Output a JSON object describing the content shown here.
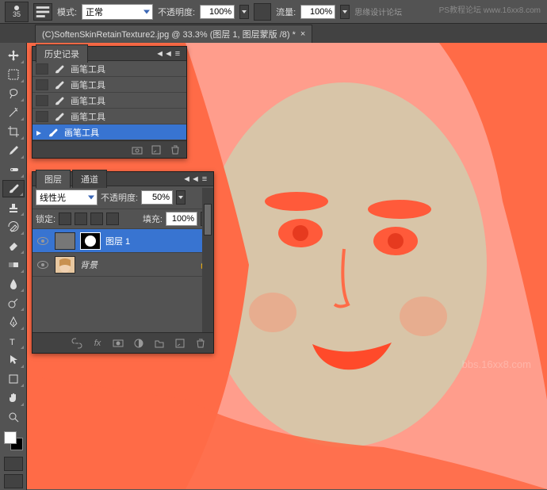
{
  "options": {
    "brush_size": "35",
    "mode_label": "模式:",
    "mode_value": "正常",
    "opacity_label": "不透明度:",
    "opacity_value": "100%",
    "flow_label": "流量:",
    "flow_value": "100%",
    "watermark_text": "思缘设计论坛"
  },
  "document": {
    "tab_title": "(C)SoftenSkinRetainTexture2.jpg @ 33.3% (图层 1, 图层蒙版 /8) *"
  },
  "history": {
    "title": "历史记录",
    "items": [
      {
        "label": "画笔工具",
        "selected": false
      },
      {
        "label": "画笔工具",
        "selected": false
      },
      {
        "label": "画笔工具",
        "selected": false
      },
      {
        "label": "画笔工具",
        "selected": false
      },
      {
        "label": "画笔工具",
        "selected": true
      }
    ]
  },
  "layers": {
    "tab_layers": "图层",
    "tab_channels": "通道",
    "blend_mode": "线性光",
    "opacity_label": "不透明度:",
    "opacity_value": "50%",
    "lock_label": "锁定:",
    "fill_label": "填充:",
    "fill_value": "100%",
    "items": [
      {
        "name": "图层 1",
        "selected": true,
        "has_mask": true
      },
      {
        "name": "背景",
        "selected": false,
        "has_mask": false,
        "locked": true
      }
    ]
  },
  "watermark": {
    "corner": "PS教程论坛  www.16xx8.com",
    "bottom": "bbs.16xx8.com"
  },
  "tools": [
    "move",
    "marquee",
    "lasso",
    "magic-wand",
    "crop",
    "eyedropper",
    "spot-heal",
    "brush",
    "stamp",
    "history-brush",
    "eraser",
    "gradient",
    "blur",
    "dodge",
    "pen",
    "type",
    "path-select",
    "rectangle",
    "hand",
    "zoom"
  ],
  "colors": {
    "selection": "#3874d1",
    "panel_bg": "#535353",
    "panel_dark": "#424242"
  }
}
